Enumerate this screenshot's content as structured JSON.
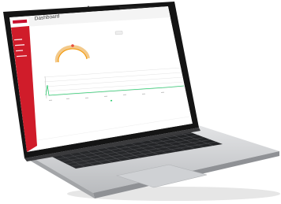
{
  "colors": {
    "brand_red": "#c8102e",
    "sidebar_red": "#d01c2a",
    "gauge_ring": "#f3c98a",
    "gauge_fill": "#f39c12",
    "gauge_marker": "#e74c3c",
    "chart_line": "#2ecc71",
    "page_bg": "#ffffff",
    "header_bg": "#f2f2f2"
  },
  "app": {
    "logo_text": "",
    "header_title": "Dashboard",
    "sidebar_items": [
      "",
      "",
      "",
      ""
    ]
  },
  "gauge_card": {
    "title": "",
    "value_label": ""
  },
  "header_button": {
    "label": ""
  },
  "chart": {
    "title": "",
    "legend": ""
  },
  "laptop": {
    "icons": [
      "webcam-icon",
      "trackpad-icon"
    ]
  }
}
